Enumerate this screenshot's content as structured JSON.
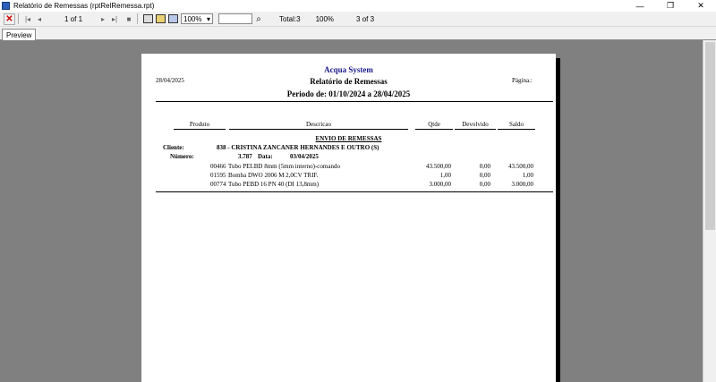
{
  "window": {
    "title": "Relatório de Remessas   (rptRelRemessa.rpt)",
    "minimize": "—",
    "maximize": "❐",
    "close": "✕"
  },
  "toolbar": {
    "close_glyph": "✕",
    "first_glyph": "|◂",
    "prev_glyph": "◂",
    "page_of": "1 of 1",
    "next_glyph": "▸",
    "last_glyph": "▸|",
    "stop_glyph": "■",
    "zoom_value": "100%",
    "zoom_arrow": "▾",
    "find_glyph": "⌕",
    "total": "Total:3",
    "percent": "100%",
    "count": "3 of 3"
  },
  "tabs": [
    {
      "label": "Preview"
    }
  ],
  "report": {
    "company": "Acqua System",
    "date": "28/04/2025",
    "title": "Relatório de Remessas",
    "page_label": "Página.:",
    "period": "Periodo de: 01/10/2024 a 28/04/2025",
    "columns": {
      "produto": "Produto",
      "descricao": "Descricao",
      "qtde": "Qtde",
      "devolvido": "Devolvido",
      "saldo": "Saldo"
    },
    "section_title": "ENVIO DE REMESSAS",
    "cliente_label": "Cliente:",
    "cliente_value": "838 - CRISTINA ZANCANER HERNANDES E OUTRO (S)",
    "numero_label": "Número:",
    "numero_value": "3.787",
    "data_label": "Data:",
    "data_value": "03/04/2025",
    "rows": [
      {
        "code": "00466",
        "desc": "Tubo PELBD 8mm (5mm interno)-comando",
        "qtde": "43.500,00",
        "devolvido": "0,00",
        "saldo": "43.500,00"
      },
      {
        "code": "01595",
        "desc": "Bomba DWO 2006 M 2,0CV TRIF.",
        "qtde": "1,00",
        "devolvido": "0,00",
        "saldo": "1,00"
      },
      {
        "code": "00774",
        "desc": "Tubo PEBD 16 PN 40 (DI 13,8mm)",
        "qtde": "3.000,00",
        "devolvido": "0,00",
        "saldo": "3.000,00"
      }
    ]
  }
}
